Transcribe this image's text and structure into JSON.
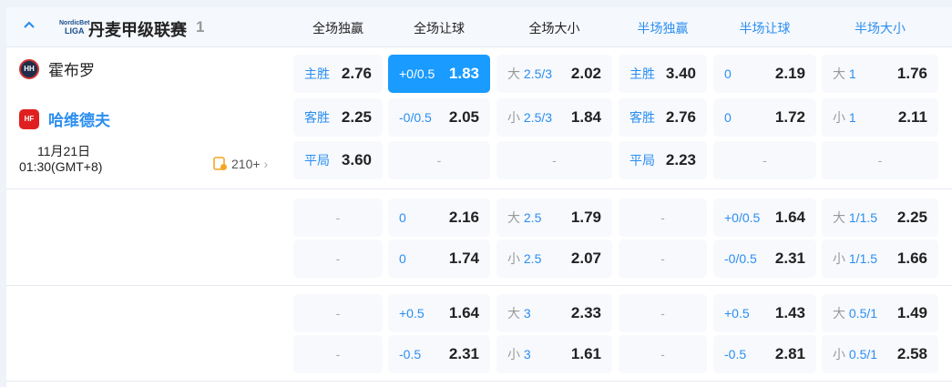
{
  "league": {
    "name": "丹麦甲级联赛",
    "count": "1",
    "logo_text": "LIGA"
  },
  "headers": [
    "全场独赢",
    "全场让球",
    "全场大小",
    "半场独赢",
    "半场让球",
    "半场大小"
  ],
  "match": {
    "home": "霍布罗",
    "away": "哈维德夫",
    "date": "11月21日",
    "time": "01:30(GMT+8)",
    "more": "210+"
  },
  "groups": [
    {
      "rows": [
        [
          {
            "l": "主胜",
            "o": "2.76"
          },
          {
            "l": "+0/0.5",
            "o": "1.83",
            "sel": true
          },
          {
            "p": "大",
            "l": "2.5/3",
            "o": "2.02"
          },
          {
            "l": "主胜",
            "o": "3.40"
          },
          {
            "l": "0",
            "o": "2.19"
          },
          {
            "p": "大",
            "l": "1",
            "o": "1.76"
          }
        ],
        [
          {
            "l": "客胜",
            "o": "2.25"
          },
          {
            "l": "-0/0.5",
            "o": "2.05"
          },
          {
            "p": "小",
            "l": "2.5/3",
            "o": "1.84"
          },
          {
            "l": "客胜",
            "o": "2.76"
          },
          {
            "l": "0",
            "o": "1.72"
          },
          {
            "p": "小",
            "l": "1",
            "o": "2.11"
          }
        ],
        [
          {
            "l": "平局",
            "o": "3.60"
          },
          {
            "d": "-"
          },
          {
            "d": "-"
          },
          {
            "l": "平局",
            "o": "2.23"
          },
          {
            "d": "-"
          },
          {
            "d": "-"
          }
        ]
      ]
    },
    {
      "rows": [
        [
          {
            "d": "-"
          },
          {
            "l": "0",
            "o": "2.16"
          },
          {
            "p": "大",
            "l": "2.5",
            "o": "1.79"
          },
          {
            "d": "-"
          },
          {
            "l": "+0/0.5",
            "o": "1.64"
          },
          {
            "p": "大",
            "l": "1/1.5",
            "o": "2.25"
          }
        ],
        [
          {
            "d": "-"
          },
          {
            "l": "0",
            "o": "1.74"
          },
          {
            "p": "小",
            "l": "2.5",
            "o": "2.07"
          },
          {
            "d": "-"
          },
          {
            "l": "-0/0.5",
            "o": "2.31"
          },
          {
            "p": "小",
            "l": "1/1.5",
            "o": "1.66"
          }
        ]
      ]
    },
    {
      "rows": [
        [
          {
            "d": "-"
          },
          {
            "l": "+0.5",
            "o": "1.64"
          },
          {
            "p": "大",
            "l": "3",
            "o": "2.33"
          },
          {
            "d": "-"
          },
          {
            "l": "+0.5",
            "o": "1.43"
          },
          {
            "p": "大",
            "l": "0.5/1",
            "o": "1.49"
          }
        ],
        [
          {
            "d": "-"
          },
          {
            "l": "-0.5",
            "o": "2.31"
          },
          {
            "p": "小",
            "l": "3",
            "o": "1.61"
          },
          {
            "d": "-"
          },
          {
            "l": "-0.5",
            "o": "2.81"
          },
          {
            "p": "小",
            "l": "0.5/1",
            "o": "2.58"
          }
        ]
      ]
    }
  ],
  "colors": {
    "accent": "#1a9bff",
    "label": "#2b8ef0"
  }
}
